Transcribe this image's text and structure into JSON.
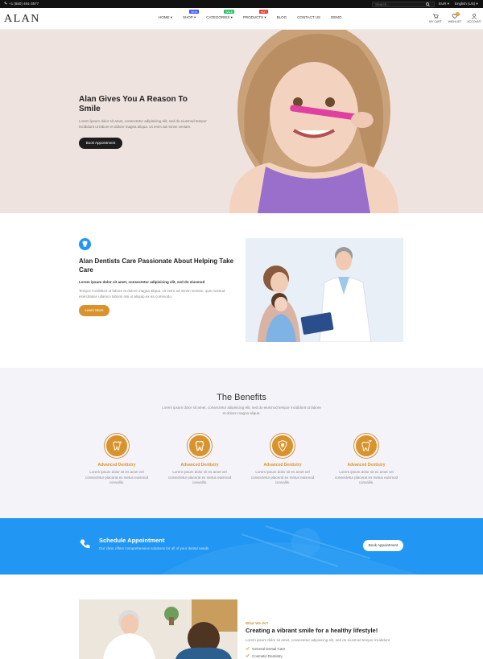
{
  "topbar": {
    "phone": "+1 (650) 491-3577",
    "search_placeholder": "Search...",
    "currency": "EUR",
    "language": "English (US)"
  },
  "header": {
    "logo": "ALAN",
    "nav": [
      {
        "label": "HOME",
        "badge": ""
      },
      {
        "label": "SHOP",
        "badge": "NEW"
      },
      {
        "label": "CATEGORIES",
        "badge": "SALE"
      },
      {
        "label": "PRODUCTS",
        "badge": "HOT"
      },
      {
        "label": "BLOG",
        "badge": ""
      },
      {
        "label": "CONTACT US",
        "badge": ""
      },
      {
        "label": "DEMO",
        "badge": ""
      }
    ],
    "icons": {
      "cart": "MY CART",
      "wishlist": "WISHLIST",
      "wishlist_count": "0",
      "account": "ACCOUNT"
    }
  },
  "hero": {
    "title": "Alan Gives You A Reason To Smile",
    "text": "Lorem ipsum dolor sit amet, consectetur adipisicing elit, sed do eiusmod tempor incididunt ut labore et dolore magna aliqua. Ut enim ad minim veniam.",
    "button": "Book Appointment"
  },
  "about": {
    "title": "Alan Dentists Care Passionate About Helping Take Care",
    "lead": "Lorem ipsum dolor sit amet, consectetur adipisicing elit, sed do eiusmod",
    "text": "Tempor incididunt ut labore et dolore magna aliqua. Ut enim ad minim veniam, quis nostrud exercitation ullamco laboris nisi ut aliquip ex ea commodo.",
    "button": "Learn More"
  },
  "benefits": {
    "title": "The Benefits",
    "intro": "Lorem ipsum dolor sit amet, consectetur adipisicing elit, sed do eiusmod tempor incididunt ut labore et dolore magna aliqua.",
    "items": [
      {
        "title": "Advanced Dentistry",
        "text": "Lorem ipsum dolor sit es amet vel consectetur placerat ex metus euismod convallis.",
        "icon": "tooth-sparkle-icon"
      },
      {
        "title": "Advanced Dentistry",
        "text": "Lorem ipsum dolor sit es amet vel consectetur placerat ex metus euismod convallis.",
        "icon": "tooth-icon"
      },
      {
        "title": "Advanced Dentistry",
        "text": "Lorem ipsum dolor sit es amet vel consectetur placerat ex metus euismod convallis.",
        "icon": "tooth-shield-icon"
      },
      {
        "title": "Advanced Dentistry",
        "text": "Lorem ipsum dolor sit es amet vel consectetur placerat ex metus euismod convallis.",
        "icon": "tooth-heart-icon"
      }
    ]
  },
  "schedule": {
    "title": "Schedule Appointment",
    "text": "Our clinic offers comprehensive solutions for all of your dental needs",
    "button": "Book Appointment"
  },
  "bottom": {
    "eyebrow": "What We do?",
    "title": "Creating a vibrant smile for a healthy lifestyle!",
    "text": "Lorem ipsum dolor sit amet, consectetur adipisicing elit, sed do eiusmod tempor incididunt",
    "list": [
      "General Dental Care",
      "Cosmetic Dentistry"
    ]
  },
  "colors": {
    "accent": "#d9932c",
    "blue": "#2196f3",
    "hero_bg": "#efe3df",
    "benefits_bg": "#f4f3f9"
  }
}
